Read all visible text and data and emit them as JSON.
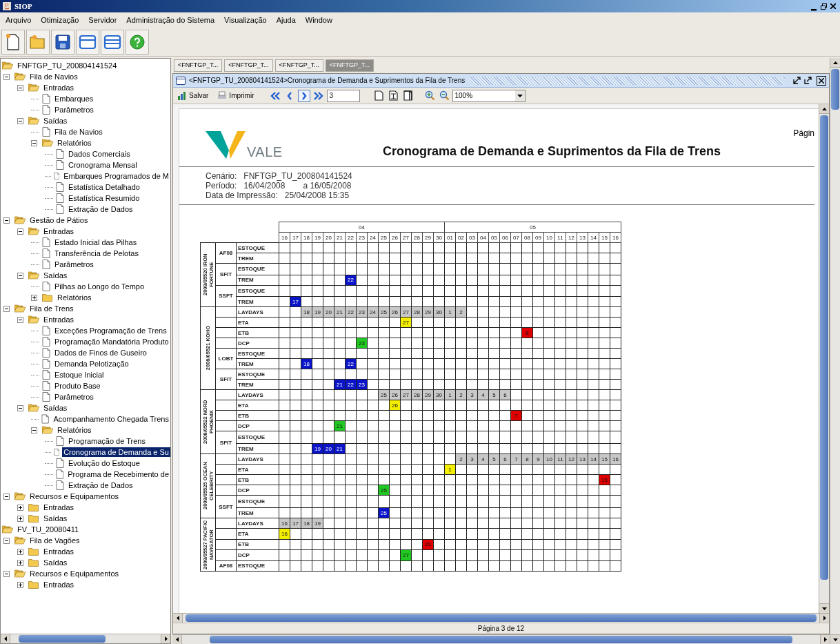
{
  "window": {
    "title": "SIOP"
  },
  "menu": [
    "Arquivo",
    "Otimização",
    "Servidor",
    "Administração do Sistema",
    "Visualização",
    "Ajuda",
    "Window"
  ],
  "tree": [
    {
      "label": "FNFTGP_TU_200804141524",
      "kind": "folder",
      "expanded": true,
      "selected": false,
      "children": [
        {
          "label": "Fila de Navios",
          "kind": "folder",
          "expanded": true,
          "selected": false,
          "children": [
            {
              "label": "Entradas",
              "kind": "folder",
              "expanded": true,
              "selected": false,
              "children": [
                {
                  "label": "Embarques",
                  "kind": "doc",
                  "selected": false
                },
                {
                  "label": "Parâmetros",
                  "kind": "doc",
                  "selected": false
                }
              ]
            },
            {
              "label": "Saídas",
              "kind": "folder",
              "expanded": true,
              "selected": false,
              "children": [
                {
                  "label": "Fila de Navios",
                  "kind": "doc",
                  "selected": false
                },
                {
                  "label": "Relatórios",
                  "kind": "folder",
                  "expanded": true,
                  "selected": false,
                  "children": [
                    {
                      "label": "Dados Comerciais",
                      "kind": "doc",
                      "selected": false
                    },
                    {
                      "label": "Cronograma Mensal",
                      "kind": "doc",
                      "selected": false
                    },
                    {
                      "label": "Embarques Programados de M",
                      "kind": "doc",
                      "selected": false
                    },
                    {
                      "label": "Estatística Detalhado",
                      "kind": "doc",
                      "selected": false
                    },
                    {
                      "label": "Estatística Resumido",
                      "kind": "doc",
                      "selected": false
                    },
                    {
                      "label": "Extração de Dados",
                      "kind": "doc",
                      "selected": false
                    }
                  ]
                }
              ]
            }
          ]
        },
        {
          "label": "Gestão de Pátios",
          "kind": "folder",
          "expanded": true,
          "selected": false,
          "children": [
            {
              "label": "Entradas",
              "kind": "folder",
              "expanded": true,
              "selected": false,
              "children": [
                {
                  "label": "Estado Inicial das Pilhas",
                  "kind": "doc",
                  "selected": false
                },
                {
                  "label": "Transferência de Pelotas",
                  "kind": "doc",
                  "selected": false
                },
                {
                  "label": "Parâmetros",
                  "kind": "doc",
                  "selected": false
                }
              ]
            },
            {
              "label": "Saídas",
              "kind": "folder",
              "expanded": true,
              "selected": false,
              "children": [
                {
                  "label": "Pilhas ao Longo do Tempo",
                  "kind": "doc",
                  "selected": false
                },
                {
                  "label": "Relatórios",
                  "kind": "folder",
                  "expanded": false,
                  "selected": false
                }
              ]
            }
          ]
        },
        {
          "label": "Fila de Trens",
          "kind": "folder",
          "expanded": true,
          "selected": false,
          "children": [
            {
              "label": "Entradas",
              "kind": "folder",
              "expanded": true,
              "selected": false,
              "children": [
                {
                  "label": "Exceções Programação de Trens",
                  "kind": "doc",
                  "selected": false
                },
                {
                  "label": "Programação Mandatória Produto",
                  "kind": "doc",
                  "selected": false
                },
                {
                  "label": "Dados de Finos de Guseiro",
                  "kind": "doc",
                  "selected": false
                },
                {
                  "label": "Demanda Pelotização",
                  "kind": "doc",
                  "selected": false
                },
                {
                  "label": "Estoque Inicial",
                  "kind": "doc",
                  "selected": false
                },
                {
                  "label": "Produto Base",
                  "kind": "doc",
                  "selected": false
                },
                {
                  "label": "Parâmetros",
                  "kind": "doc",
                  "selected": false
                }
              ]
            },
            {
              "label": "Saídas",
              "kind": "folder",
              "expanded": true,
              "selected": false,
              "children": [
                {
                  "label": "Acompanhamento Chegada Trens",
                  "kind": "doc",
                  "selected": false
                },
                {
                  "label": "Relatórios",
                  "kind": "folder",
                  "expanded": true,
                  "selected": false,
                  "children": [
                    {
                      "label": "Programação de Trens",
                      "kind": "doc",
                      "selected": false
                    },
                    {
                      "label": "Cronograma de Demanda e Su",
                      "kind": "doc",
                      "selected": true
                    },
                    {
                      "label": "Evolução do Estoque",
                      "kind": "doc",
                      "selected": false
                    },
                    {
                      "label": "Programa de Recebimento de",
                      "kind": "doc",
                      "selected": false
                    },
                    {
                      "label": "Extração de Dados",
                      "kind": "doc",
                      "selected": false
                    }
                  ]
                }
              ]
            }
          ]
        },
        {
          "label": "Recursos e Equipamentos",
          "kind": "folder",
          "expanded": true,
          "selected": false,
          "children": [
            {
              "label": "Entradas",
              "kind": "folder",
              "expanded": false,
              "selected": false
            },
            {
              "label": "Saídas",
              "kind": "folder",
              "expanded": false,
              "selected": false
            }
          ]
        }
      ]
    },
    {
      "label": "FV_TU_20080411",
      "kind": "folder",
      "expanded": true,
      "selected": false,
      "children": [
        {
          "label": "Fila de Vagões",
          "kind": "folder",
          "expanded": true,
          "selected": false,
          "children": [
            {
              "label": "Entradas",
              "kind": "folder",
              "expanded": false,
              "selected": false
            },
            {
              "label": "Saídas",
              "kind": "folder",
              "expanded": false,
              "selected": false
            }
          ]
        },
        {
          "label": "Recursos e Equipamentos",
          "kind": "folder",
          "expanded": true,
          "selected": false,
          "children": [
            {
              "label": "Entradas",
              "kind": "folder",
              "expanded": false,
              "selected": false
            }
          ]
        }
      ]
    }
  ],
  "tabs": [
    {
      "label": "<FNFTGP_T...",
      "selected": false
    },
    {
      "label": "<FNFTGP_T...",
      "selected": false
    },
    {
      "label": "<FNFTGP_T...",
      "selected": false
    },
    {
      "label": "<FNFTGP_T...",
      "selected": true
    }
  ],
  "frame": {
    "title": "<FNFTGP_TU_200804141524>Cronograma de Demanda e Suprimentos da Fila de Trens"
  },
  "toolbar": {
    "save": "Salvar",
    "print": "Imprimir",
    "page": "3",
    "zoom": "100%"
  },
  "report": {
    "logo": "VALE",
    "title": "Cronograma de Demanda e Suprimentos da Fila de Trens",
    "page_label": "Págin",
    "info": [
      {
        "label": "Cenário:",
        "values": [
          "FNFTGP_TU_200804141524"
        ]
      },
      {
        "label": "Período:",
        "values": [
          "16/04/2008",
          "a 16/05/2008"
        ]
      },
      {
        "label": "Data de Impressão:",
        "values": [
          "25/04/2008 15:35"
        ]
      }
    ],
    "months": [
      {
        "label": "04",
        "days": [
          "16",
          "17",
          "18",
          "19",
          "20",
          "21",
          "22",
          "23",
          "24",
          "25",
          "26",
          "27",
          "28",
          "29",
          "30"
        ]
      },
      {
        "label": "05",
        "days": [
          "01",
          "02",
          "03",
          "04",
          "05",
          "06",
          "07",
          "08",
          "09",
          "10",
          "11",
          "12",
          "13",
          "14",
          "15",
          "16"
        ]
      }
    ],
    "ships": [
      {
        "name": "2008/05520 IRON FORTUNE",
        "sections": [
          {
            "group": "AF08",
            "rows": [
              {
                "label": "ESTOQUE"
              },
              {
                "label": "TREM"
              }
            ]
          },
          {
            "group": "SFIT",
            "rows": [
              {
                "label": "ESTOQUE"
              },
              {
                "label": "TREM",
                "cells": [
                  null,
                  null,
                  null,
                  null,
                  null,
                  null,
                  {
                    "text": "22",
                    "color": "#0a14c8"
                  }
                ]
              }
            ]
          },
          {
            "group": "SSFT",
            "rows": [
              {
                "label": "ESTOQUE"
              },
              {
                "label": "TREM",
                "cells": [
                  null,
                  {
                    "text": "17",
                    "color": "#0a14c8"
                  }
                ]
              }
            ]
          }
        ]
      },
      {
        "name": "2008/05521 KOHO",
        "sections": [
          {
            "rows": [
              {
                "label": "LAYDAYS",
                "cells": [
                  null,
                  null,
                  {
                    "text": "18",
                    "color": "#c8c8c8"
                  },
                  {
                    "text": "19",
                    "color": "#c8c8c8"
                  },
                  {
                    "text": "20",
                    "color": "#c8c8c8"
                  },
                  {
                    "text": "21",
                    "color": "#c8c8c8"
                  },
                  {
                    "text": "22",
                    "color": "#c8c8c8"
                  },
                  {
                    "text": "23",
                    "color": "#c8c8c8"
                  },
                  {
                    "text": "24",
                    "color": "#c8c8c8"
                  },
                  {
                    "text": "25",
                    "color": "#c8c8c8"
                  },
                  {
                    "text": "26",
                    "color": "#c8c8c8"
                  },
                  {
                    "text": "27",
                    "color": "#c8c8c8"
                  },
                  {
                    "text": "28",
                    "color": "#c8c8c8"
                  },
                  {
                    "text": "29",
                    "color": "#c8c8c8"
                  },
                  {
                    "text": "30",
                    "color": "#c8c8c8"
                  },
                  {
                    "text": "1",
                    "color": "#c8c8c8"
                  },
                  {
                    "text": "2",
                    "color": "#c8c8c8"
                  }
                ]
              },
              {
                "label": "ETA",
                "cells": [
                  null,
                  null,
                  null,
                  null,
                  null,
                  null,
                  null,
                  null,
                  null,
                  null,
                  null,
                  {
                    "text": "27",
                    "color": "#f4ee00"
                  }
                ]
              },
              {
                "label": "ETB",
                "cells": [
                  null,
                  null,
                  null,
                  null,
                  null,
                  null,
                  null,
                  null,
                  null,
                  null,
                  null,
                  null,
                  null,
                  null,
                  null,
                  null,
                  null,
                  null,
                  null,
                  null,
                  null,
                  null,
                  {
                    "text": "8",
                    "color": "#e00000"
                  }
                ]
              },
              {
                "label": "DCP",
                "cells": [
                  null,
                  null,
                  null,
                  null,
                  null,
                  null,
                  null,
                  {
                    "text": "23",
                    "color": "#22c822"
                  }
                ]
              }
            ]
          },
          {
            "group": "LOBT",
            "rows": [
              {
                "label": "ESTOQUE"
              },
              {
                "label": "TREM",
                "cells": [
                  null,
                  null,
                  {
                    "text": "18",
                    "color": "#0a14c8"
                  },
                  null,
                  null,
                  null,
                  {
                    "text": "22",
                    "color": "#0a14c8"
                  }
                ]
              }
            ]
          },
          {
            "group": "SFIT",
            "rows": [
              {
                "label": "ESTOQUE"
              },
              {
                "label": "TREM",
                "cells": [
                  null,
                  null,
                  null,
                  null,
                  null,
                  {
                    "text": "21",
                    "color": "#0a14c8"
                  },
                  {
                    "text": "22",
                    "color": "#0a14c8"
                  },
                  {
                    "text": "23",
                    "color": "#0a14c8"
                  }
                ]
              }
            ]
          }
        ]
      },
      {
        "name": "2008/05522 NORD PHOENIX",
        "sections": [
          {
            "rows": [
              {
                "label": "LAYDAYS",
                "cells": [
                  null,
                  null,
                  null,
                  null,
                  null,
                  null,
                  null,
                  null,
                  null,
                  {
                    "text": "25",
                    "color": "#c8c8c8"
                  },
                  {
                    "text": "26",
                    "color": "#c8c8c8"
                  },
                  {
                    "text": "27",
                    "color": "#c8c8c8"
                  },
                  {
                    "text": "28",
                    "color": "#c8c8c8"
                  },
                  {
                    "text": "29",
                    "color": "#c8c8c8"
                  },
                  {
                    "text": "30",
                    "color": "#c8c8c8"
                  },
                  {
                    "text": "1",
                    "color": "#c8c8c8"
                  },
                  {
                    "text": "2",
                    "color": "#c8c8c8"
                  },
                  {
                    "text": "3",
                    "color": "#c8c8c8"
                  },
                  {
                    "text": "4",
                    "color": "#c8c8c8"
                  },
                  {
                    "text": "5",
                    "color": "#c8c8c8"
                  },
                  {
                    "text": "6",
                    "color": "#c8c8c8"
                  }
                ]
              },
              {
                "label": "ETA",
                "cells": [
                  null,
                  null,
                  null,
                  null,
                  null,
                  null,
                  null,
                  null,
                  null,
                  null,
                  {
                    "text": "26",
                    "color": "#f4ee00"
                  }
                ]
              },
              {
                "label": "ETB",
                "cells": [
                  null,
                  null,
                  null,
                  null,
                  null,
                  null,
                  null,
                  null,
                  null,
                  null,
                  null,
                  null,
                  null,
                  null,
                  null,
                  null,
                  null,
                  null,
                  null,
                  null,
                  null,
                  {
                    "text": "7",
                    "color": "#e00000"
                  }
                ]
              },
              {
                "label": "DCP",
                "cells": [
                  null,
                  null,
                  null,
                  null,
                  null,
                  {
                    "text": "21",
                    "color": "#22c822"
                  }
                ]
              }
            ]
          },
          {
            "group": "SFIT",
            "rows": [
              {
                "label": "ESTOQUE"
              },
              {
                "label": "TREM",
                "cells": [
                  null,
                  null,
                  null,
                  {
                    "text": "19",
                    "color": "#0a14c8"
                  },
                  {
                    "text": "20",
                    "color": "#0a14c8"
                  },
                  {
                    "text": "21",
                    "color": "#0a14c8"
                  }
                ]
              }
            ]
          }
        ]
      },
      {
        "name": "2008/05525 OCEAN CELEBRITY",
        "sections": [
          {
            "rows": [
              {
                "label": "LAYDAYS",
                "cells": [
                  null,
                  null,
                  null,
                  null,
                  null,
                  null,
                  null,
                  null,
                  null,
                  null,
                  null,
                  null,
                  null,
                  null,
                  null,
                  null,
                  {
                    "text": "2",
                    "color": "#c8c8c8"
                  },
                  {
                    "text": "3",
                    "color": "#c8c8c8"
                  },
                  {
                    "text": "4",
                    "color": "#c8c8c8"
                  },
                  {
                    "text": "5",
                    "color": "#c8c8c8"
                  },
                  {
                    "text": "6",
                    "color": "#c8c8c8"
                  },
                  {
                    "text": "7",
                    "color": "#c8c8c8"
                  },
                  {
                    "text": "8",
                    "color": "#c8c8c8"
                  },
                  {
                    "text": "9",
                    "color": "#c8c8c8"
                  },
                  {
                    "text": "10",
                    "color": "#c8c8c8"
                  },
                  {
                    "text": "11",
                    "color": "#c8c8c8"
                  },
                  {
                    "text": "12",
                    "color": "#c8c8c8"
                  },
                  {
                    "text": "13",
                    "color": "#c8c8c8"
                  },
                  {
                    "text": "14",
                    "color": "#c8c8c8"
                  },
                  {
                    "text": "15",
                    "color": "#c8c8c8"
                  },
                  {
                    "text": "16",
                    "color": "#c8c8c8"
                  }
                ]
              },
              {
                "label": "ETA",
                "cells": [
                  null,
                  null,
                  null,
                  null,
                  null,
                  null,
                  null,
                  null,
                  null,
                  null,
                  null,
                  null,
                  null,
                  null,
                  null,
                  {
                    "text": "1",
                    "color": "#f4ee00"
                  }
                ]
              },
              {
                "label": "ETB",
                "cells": [
                  null,
                  null,
                  null,
                  null,
                  null,
                  null,
                  null,
                  null,
                  null,
                  null,
                  null,
                  null,
                  null,
                  null,
                  null,
                  null,
                  null,
                  null,
                  null,
                  null,
                  null,
                  null,
                  null,
                  null,
                  null,
                  null,
                  null,
                  null,
                  null,
                  {
                    "text": "15",
                    "color": "#e00000"
                  }
                ]
              },
              {
                "label": "DCP",
                "cells": [
                  null,
                  null,
                  null,
                  null,
                  null,
                  null,
                  null,
                  null,
                  null,
                  {
                    "text": "25",
                    "color": "#22c822"
                  }
                ]
              }
            ]
          },
          {
            "group": "SSFT",
            "rows": [
              {
                "label": "ESTOQUE"
              },
              {
                "label": "TREM",
                "cells": [
                  null,
                  null,
                  null,
                  null,
                  null,
                  null,
                  null,
                  null,
                  null,
                  {
                    "text": "25",
                    "color": "#0a14c8"
                  }
                ]
              }
            ]
          }
        ]
      },
      {
        "name": "2008/05527 PACIFIC NAVIGATOR",
        "sections": [
          {
            "rows": [
              {
                "label": "LAYDAYS",
                "cells": [
                  {
                    "text": "16",
                    "color": "#c8c8c8"
                  },
                  {
                    "text": "17",
                    "color": "#c8c8c8"
                  },
                  {
                    "text": "18",
                    "color": "#c8c8c8"
                  },
                  {
                    "text": "19",
                    "color": "#c8c8c8"
                  }
                ]
              },
              {
                "label": "ETA",
                "cells": [
                  {
                    "text": "16",
                    "color": "#f4ee00"
                  }
                ]
              },
              {
                "label": "ETB",
                "cells": [
                  null,
                  null,
                  null,
                  null,
                  null,
                  null,
                  null,
                  null,
                  null,
                  null,
                  null,
                  null,
                  null,
                  {
                    "text": "29",
                    "color": "#e00000"
                  }
                ]
              },
              {
                "label": "DCP",
                "cells": [
                  null,
                  null,
                  null,
                  null,
                  null,
                  null,
                  null,
                  null,
                  null,
                  null,
                  null,
                  {
                    "text": "27",
                    "color": "#22c822"
                  }
                ]
              }
            ]
          },
          {
            "group": "AF08",
            "rows": [
              {
                "label": "ESTOQUE"
              }
            ]
          }
        ]
      }
    ]
  },
  "status": "Página 3 de 12"
}
